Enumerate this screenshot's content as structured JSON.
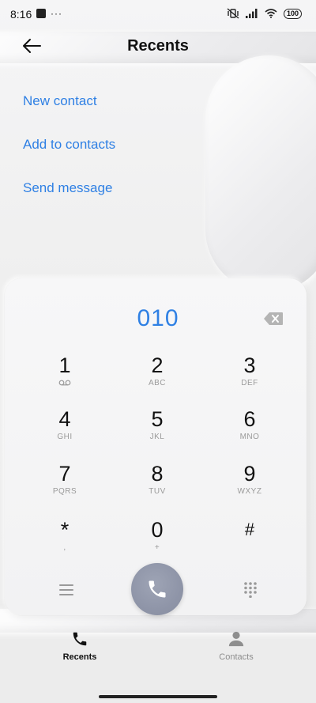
{
  "status_bar": {
    "time": "8:16",
    "overflow": "···",
    "battery": "100"
  },
  "header": {
    "title": "Recents",
    "back_icon": "arrow-left-icon"
  },
  "actions": [
    {
      "label": "New contact"
    },
    {
      "label": "Add to contacts"
    },
    {
      "label": "Send message"
    }
  ],
  "dialpad": {
    "number": "010",
    "backspace_icon": "backspace-icon",
    "keys": [
      {
        "digit": "1",
        "letters": ""
      },
      {
        "digit": "2",
        "letters": "ABC"
      },
      {
        "digit": "3",
        "letters": "DEF"
      },
      {
        "digit": "4",
        "letters": "GHI"
      },
      {
        "digit": "5",
        "letters": "JKL"
      },
      {
        "digit": "6",
        "letters": "MNO"
      },
      {
        "digit": "7",
        "letters": "PQRS"
      },
      {
        "digit": "8",
        "letters": "TUV"
      },
      {
        "digit": "9",
        "letters": "WXYZ"
      },
      {
        "digit": "*",
        "letters": ","
      },
      {
        "digit": "0",
        "letters": "+"
      },
      {
        "digit": "#",
        "letters": ""
      }
    ]
  },
  "nav": {
    "recents_label": "Recents",
    "contacts_label": "Contacts"
  },
  "colors": {
    "accent": "#2f80e4",
    "call_button": "#8f95a8"
  }
}
